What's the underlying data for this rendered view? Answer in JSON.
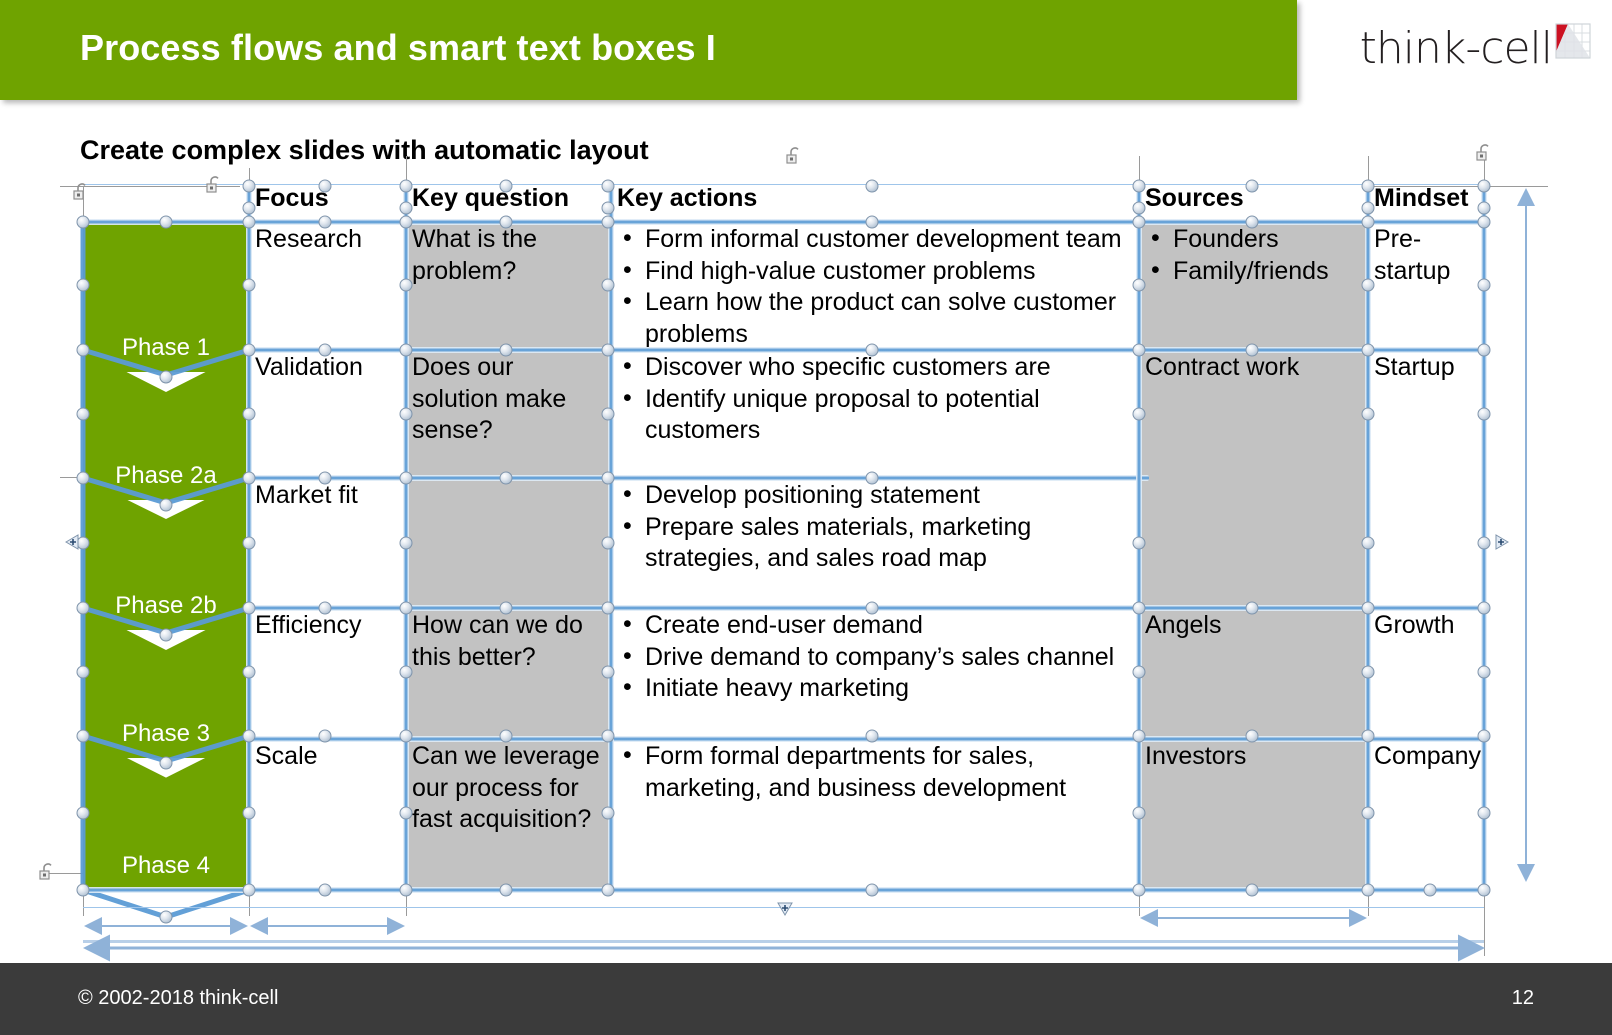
{
  "header": {
    "title": "Process flows and smart text boxes I",
    "logo_text": "think-cell",
    "brand_green": "#6FA300",
    "logo_red": "#CC1122"
  },
  "subtitle": "Create complex slides with automatic layout",
  "table": {
    "columns": [
      "",
      "Focus",
      "Key question",
      "Key actions",
      "Sources",
      "Mindset"
    ],
    "rows": [
      {
        "phase": "Phase 1",
        "focus": "Research",
        "key_question": "What is the problem?",
        "key_actions": [
          "Form informal customer development team",
          "Find high-value customer problems",
          "Learn how the product can solve customer problems"
        ],
        "sources": [
          "Founders",
          "Family/friends"
        ],
        "sources_bulleted": true,
        "mindset": "Pre-startup"
      },
      {
        "phase": "Phase 2a",
        "focus": "Validation",
        "key_question": "Does our solution make sense?",
        "key_actions": [
          "Discover who specific customers are",
          "Identify unique proposal to potential customers"
        ],
        "sources": [
          "Contract work"
        ],
        "sources_bulleted": false,
        "mindset": "Startup"
      },
      {
        "phase": "Phase 2b",
        "focus": "Market fit",
        "key_question": "",
        "key_actions": [
          "Develop positioning statement",
          "Prepare sales materials, marketing strategies, and sales road map"
        ],
        "sources": [],
        "sources_bulleted": false,
        "mindset": ""
      },
      {
        "phase": "Phase 3",
        "focus": "Efficiency",
        "key_question": "How can we do this better?",
        "key_actions": [
          "Create end-user demand",
          "Drive demand to company’s sales channel",
          "Initiate heavy marketing"
        ],
        "sources": [
          "Angels"
        ],
        "sources_bulleted": false,
        "mindset": "Growth"
      },
      {
        "phase": "Phase 4",
        "focus": "Scale",
        "key_question": "Can we leverage our process for fast acquisition?",
        "key_actions": [
          "Form formal departments for sales, marketing, and business development"
        ],
        "sources": [
          "Investors"
        ],
        "sources_bulleted": false,
        "mindset": "Company"
      }
    ],
    "gray_fill": "#C2C2C2",
    "selection_color": "#5B9BD5"
  },
  "footer": {
    "copyright": "© 2002-2018 think-cell",
    "page_number": "12"
  }
}
